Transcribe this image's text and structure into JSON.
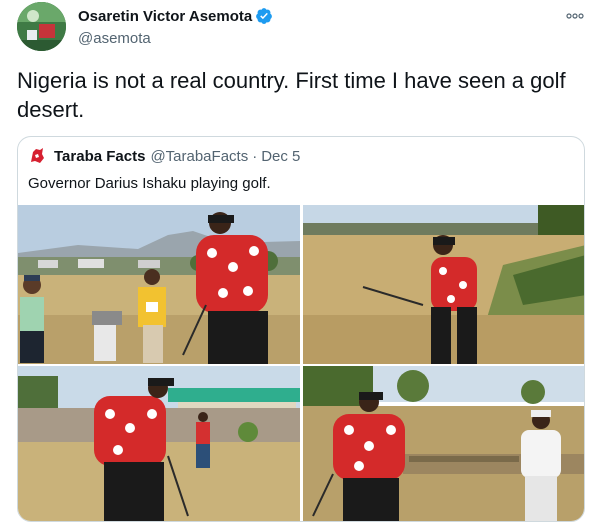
{
  "tweet": {
    "author_name": "Osaretin Victor Asemota",
    "handle": "@asemota",
    "verified_icon": "verified-badge-icon",
    "more_icon": "more-options-icon",
    "text": "Nigeria is not a real country. First time I have seen a golf desert.",
    "accent_color": "#1d9bf0"
  },
  "quote": {
    "name": "Taraba Facts",
    "handle": "@TarabaFacts",
    "separator": "·",
    "date": "Dec 5",
    "text": "Governor Darius Ishaku playing golf.",
    "photos": [
      {
        "name": "photo-1"
      },
      {
        "name": "photo-2"
      },
      {
        "name": "photo-3"
      },
      {
        "name": "photo-4"
      }
    ]
  }
}
